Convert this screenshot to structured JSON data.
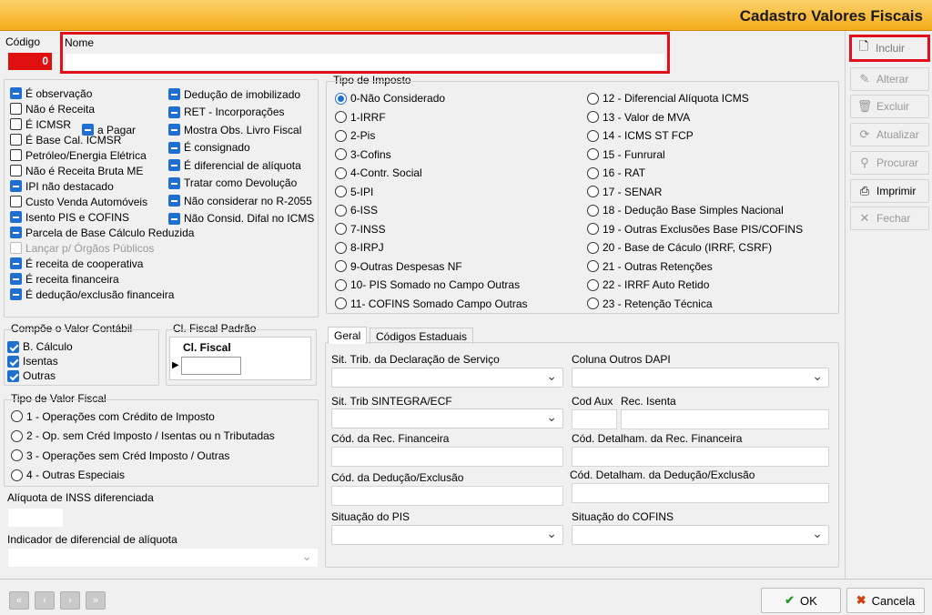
{
  "window": {
    "title": "Cadastro Valores Fiscais"
  },
  "codigo": {
    "label": "Código",
    "value": "0"
  },
  "nome": {
    "label": "Nome",
    "value": ""
  },
  "checks": {
    "col1": [
      {
        "label": "É observação",
        "state": "ind"
      },
      {
        "label": "Não é Receita",
        "state": "off"
      },
      {
        "label": "É ICMSR",
        "state": "off"
      },
      {
        "label": "É Base Cal. ICMSR",
        "state": "off"
      },
      {
        "label": "Petróleo/Energia Elétrica",
        "state": "off"
      },
      {
        "label": "Não é Receita Bruta ME",
        "state": "off"
      },
      {
        "label": "IPI não destacado",
        "state": "ind"
      },
      {
        "label": "Custo Venda Automóveis",
        "state": "off"
      },
      {
        "label": "Isento PIS e COFINS",
        "state": "ind"
      },
      {
        "label": "Parcela de Base Cálculo Reduzida",
        "state": "ind"
      },
      {
        "label": "Lançar p/ Órgãos Públicos",
        "state": "dis"
      },
      {
        "label": "É receita de cooperativa",
        "state": "ind"
      },
      {
        "label": "É receita financeira",
        "state": "ind"
      },
      {
        "label": "É dedução/exclusão financeira",
        "state": "ind"
      }
    ],
    "apagar": {
      "label": "a Pagar",
      "state": "ind"
    },
    "col2": [
      {
        "label": "Dedução de imobilizado",
        "state": "ind"
      },
      {
        "label": "RET - Incorporações",
        "state": "ind"
      },
      {
        "label": "Mostra Obs. Livro Fiscal",
        "state": "ind"
      },
      {
        "label": "É consignado",
        "state": "ind"
      },
      {
        "label": "É diferencial de alíquota",
        "state": "ind"
      },
      {
        "label": "Tratar como Devolução",
        "state": "ind"
      },
      {
        "label": "Não considerar no R-2055",
        "state": "ind"
      },
      {
        "label": "Não Consid. Difal no ICMS",
        "state": "ind"
      }
    ]
  },
  "compoe": {
    "title": "Compõe o Valor Contábil",
    "items": [
      "B. Cálculo",
      "Isentas",
      "Outras"
    ]
  },
  "clfiscal": {
    "title": "Cl. Fiscal Padrão",
    "header": "Cl. Fiscal"
  },
  "tipovalor": {
    "title": "Tipo de Valor Fiscal",
    "items": [
      "1 - Operações com Crédito de Imposto",
      "2 - Op. sem Créd Imposto / Isentas ou n Tributadas",
      "3 - Operações sem Créd Imposto / Outras",
      "4 - Outras Especiais"
    ]
  },
  "inss": {
    "label": "Alíquota de INSS diferenciada"
  },
  "indicador": {
    "label": "Indicador de diferencial de alíquota"
  },
  "tipoimposto": {
    "title": "Tipo de Imposto",
    "col1": [
      "0-Não Considerado",
      "1-IRRF",
      "2-Pis",
      "3-Cofins",
      "4-Contr. Social",
      "5-IPI",
      "6-ISS",
      "7-INSS",
      "8-IRPJ",
      "9-Outras Despesas NF",
      "10- PIS Somado no Campo Outras",
      "11- COFINS Somado Campo Outras"
    ],
    "col2": [
      "12 - Diferencial Alíquota ICMS",
      "13 - Valor de MVA",
      "14 - ICMS ST FCP",
      "15 - Funrural",
      "16 - RAT",
      "17 - SENAR",
      "18 - Dedução Base Simples Nacional",
      "19 - Outras Exclusões Base PIS/COFINS",
      "20 - Base de Cáculo (IRRF, CSRF)",
      "21 - Outras Retenções",
      "22 - IRRF Auto Retido",
      "23 - Retenção Técnica"
    ]
  },
  "tabs": [
    "Geral",
    "Códigos Estaduais"
  ],
  "geral": {
    "sit_trib_servico": "Sit. Trib. da Declaração de Serviço",
    "coluna_dapi": "Coluna Outros DAPI",
    "sit_sintegra": "Sit. Trib SINTEGRA/ECF",
    "cod_aux": "Cod Aux",
    "rec_isenta": "Rec. Isenta",
    "cod_rec_fin": "Cód. da Rec. Financeira",
    "cod_det_rec_fin": "Cód. Detalham. da Rec. Financeira",
    "cod_ded_exc": "Cód. da Dedução/Exclusão",
    "cod_det_ded_exc": "Cód. Detalham. da Dedução/Exclusão",
    "sit_pis": "Situação do PIS",
    "sit_cofins": "Situação do COFINS"
  },
  "sidebar": {
    "incluir": "Incluir",
    "alterar": "Alterar",
    "excluir": "Excluir",
    "atualizar": "Atualizar",
    "procurar": "Procurar",
    "imprimir": "Imprimir",
    "fechar": "Fechar"
  },
  "footer": {
    "ok": "OK",
    "cancela": "Cancela"
  }
}
